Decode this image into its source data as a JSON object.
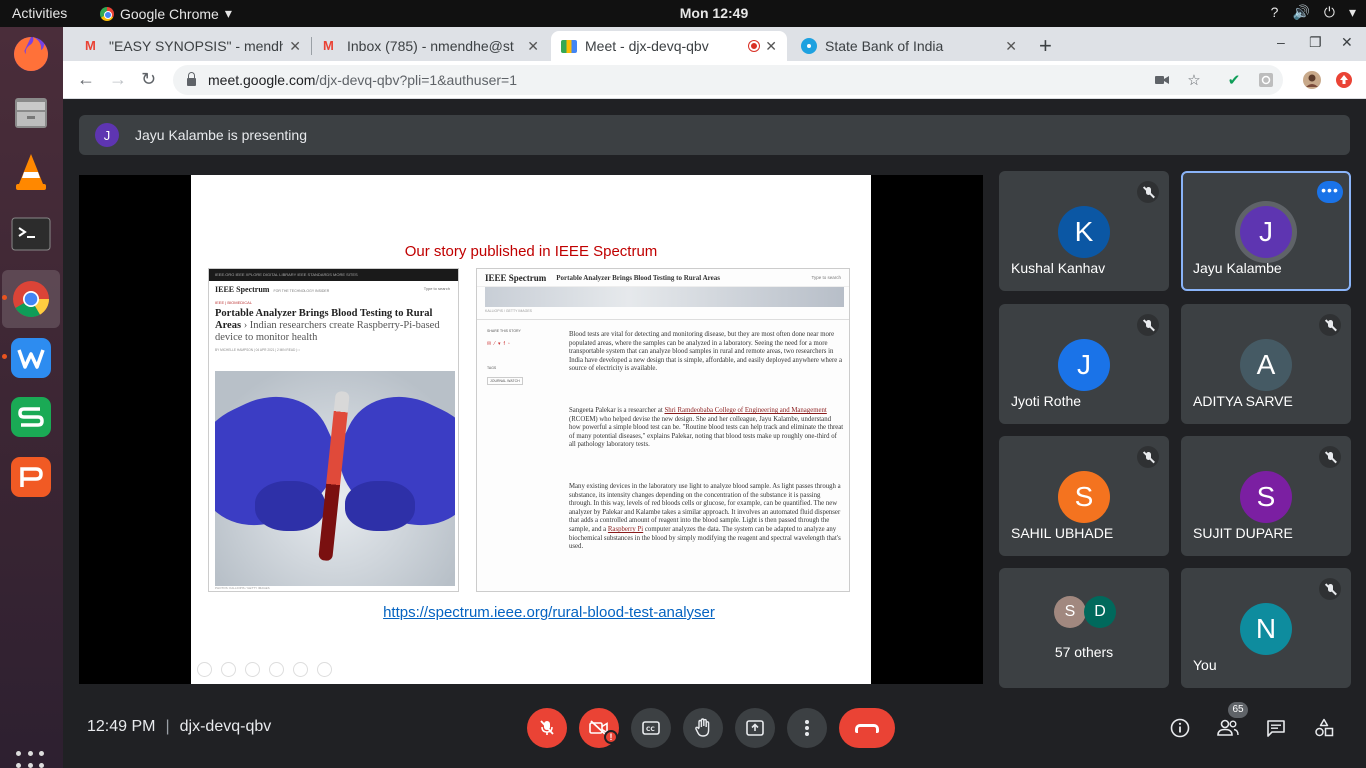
{
  "topbar": {
    "activities": "Activities",
    "app_name": "Google Chrome",
    "app_menu_arrow": "▾",
    "clock": "Mon 12:49",
    "tray": [
      "?",
      "🔊",
      "⏻",
      "▾"
    ]
  },
  "dock": {
    "items": [
      {
        "name": "firefox-icon",
        "color": "#ff7139"
      },
      {
        "name": "files-icon",
        "color": "#9a9a9a"
      },
      {
        "name": "vlc-icon",
        "color": "#ff8800"
      },
      {
        "name": "terminal-icon",
        "color": "#333333"
      },
      {
        "name": "chrome-icon",
        "color": "#4285f4"
      },
      {
        "name": "wps-writer-icon",
        "color": "#2d8cf0"
      },
      {
        "name": "wps-spreadsheets-icon",
        "color": "#1aaa55"
      },
      {
        "name": "wps-presentation-icon",
        "color": "#f15a24"
      }
    ]
  },
  "browser": {
    "tabs": [
      {
        "title": "\"EASY SYNOPSIS\" - mendh",
        "icon": "gmail-icon"
      },
      {
        "title": "Inbox (785) - nmendhe@st",
        "icon": "gmail-icon"
      },
      {
        "title": "Meet - djx-devq-qbv",
        "icon": "meet-icon"
      },
      {
        "title": "State Bank of India",
        "icon": "sbi-icon"
      }
    ],
    "close_glyph": "✕",
    "new_tab": "+",
    "window_controls": [
      "–",
      "❐",
      "✕"
    ],
    "url_host": "meet.google.com",
    "url_path": "/djx-devq-qbv?pli=1&authuser=1",
    "nav": {
      "back": "←",
      "forward": "→",
      "reload": "↻"
    }
  },
  "meet": {
    "presenter_initial": "J",
    "presenting_text": "Jayu Kalambe is presenting",
    "slide": {
      "title": "Our story published in IEEE Spectrum",
      "link": "https://spectrum.ieee.org/rural-blood-test-analyser",
      "left_shot": {
        "topbar": "IEEE.ORG   IEEE XPLORE DIGITAL LIBRARY   IEEE STANDARDS   MORE SITES",
        "logo": "IEEE Spectrum",
        "tagline": "FOR THE TECHNOLOGY INSIDER",
        "search": "Type to search",
        "section": "IEEE  | BIOMEDICAL",
        "headline_bold": "Portable Analyzer Brings Blood Testing to Rural Areas",
        "headline_rest": " › Indian researchers create Raspberry-Pi-based device to monitor health",
        "byline": "BY MICHELLE HAMPSON  |  04 APR 2021  |  2 MIN READ  |  □",
        "credit": "PHOTOS: KALLIOPIS / GETTY IMAGES"
      },
      "right_shot": {
        "logo": "IEEE Spectrum",
        "header_title": "Portable Analyzer Brings Blood Testing to Rural Areas",
        "search": "Type to search",
        "credit": "KALLIOPIS / GETTY IMAGES",
        "share_label": "SHARE THIS STORY",
        "tags_label": "TAGS",
        "tag": "JOURNAL WATCH",
        "p1": "Blood tests are vital for detecting and monitoring disease, but they are most often done near more populated areas, where the samples can be analyzed in a laboratory. Seeing the need for a more transportable system that can analyze blood samples in rural and remote areas, two researchers in India have developed a new design that is simple, affordable, and easily deployed anywhere where a source of electricity is available.",
        "p2_before": "Sangeeta Palekar is a researcher at ",
        "p2_link": "Shri Ramdeobaba College of Engineering and Management",
        "p2_after": " (RCOEM) who helped devise the new design. She and her colleague, Jayu Kalambe, understand how powerful a simple blood test can be. \"Routine blood tests can help track and eliminate the threat of many potential diseases,\" explains Palekar, noting that blood tests make up roughly one-third of all pathology laboratory tests.",
        "p3_before": "Many existing devices in the laboratory use light to analyze blood sample. As light passes through a substance, its intensity changes depending on the concentration of the substance it is passing through. In this way, levels of red bloods cells or glucose, for example, can be quantified. The new analyzer by Palekar and Kalambe takes a similar approach. It involves an automated fluid dispenser that adds a controlled amount of reagent into the blood sample. Light is then passed through the sample, and a ",
        "p3_link": "Raspberry Pi",
        "p3_after": " computer analyzes the data. The system can be adapted to analyze any biochemical substances in the blood by simply modifying the reagent and spectral wavelength that's used."
      }
    },
    "participants": [
      {
        "initial": "K",
        "name": "Kushal Kanhav",
        "color": "#0b57a4",
        "muted": true
      },
      {
        "initial": "J",
        "name": "Jayu Kalambe",
        "color": "#5e35b1",
        "muted": false,
        "pinned": true
      },
      {
        "initial": "J",
        "name": "Jyoti Rothe",
        "color": "#1a73e8",
        "muted": true
      },
      {
        "initial": "A",
        "name": "ADITYA SARVE",
        "color": "#455a64",
        "muted": true
      },
      {
        "initial": "S",
        "name": "SAHIL UBHADE",
        "color": "#f4731f",
        "muted": true
      },
      {
        "initial": "S",
        "name": "SUJIT DUPARE",
        "color": "#7b1fa2",
        "muted": true
      }
    ],
    "others": {
      "initials": [
        "S",
        "D"
      ],
      "colors": [
        "#a1887f",
        "#00695c"
      ],
      "label": "57 others"
    },
    "self": {
      "initial": "N",
      "name": "You",
      "color": "#0e8c9e",
      "muted": true
    },
    "more_options": "•••",
    "bottom": {
      "time": "12:49 PM",
      "separator": "|",
      "meeting_code": "djx-devq-qbv",
      "participant_count": "65",
      "camera_warning": "!"
    }
  }
}
